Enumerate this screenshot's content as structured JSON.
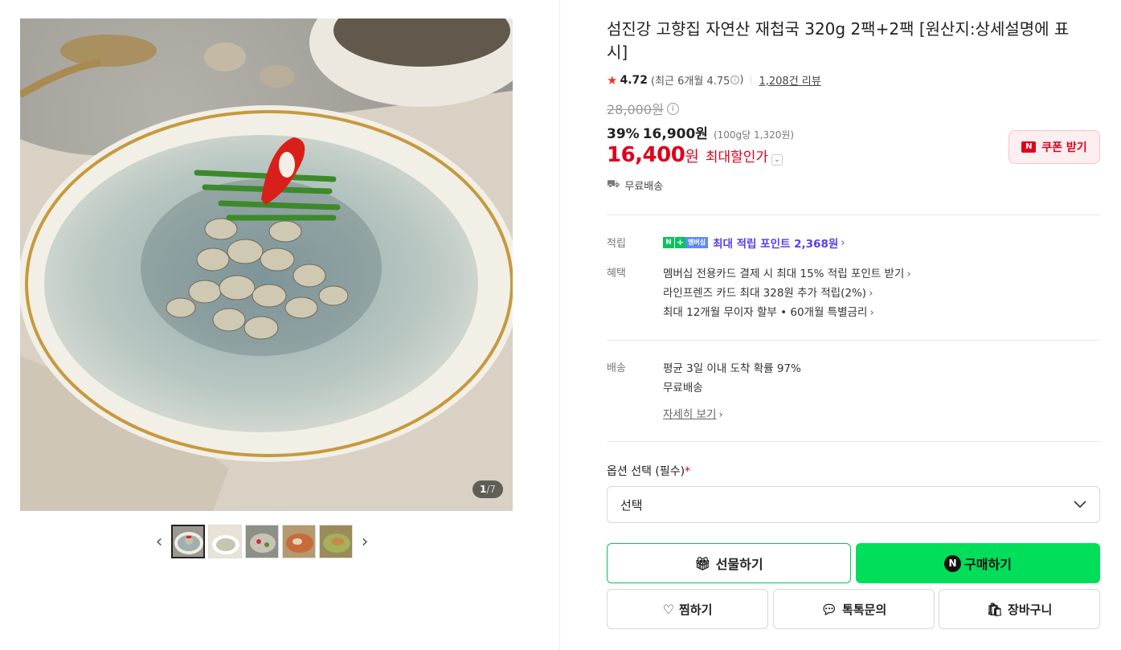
{
  "gallery": {
    "counter_current": "1",
    "counter_total": "/7",
    "prev_icon": "chevron-left-icon",
    "next_icon": "chevron-right-icon"
  },
  "product": {
    "title": "섬진강 고향집 자연산 재첩국 320g 2팩+2팩 [원산지:상세설명에 표시]",
    "rating_score": "4.72",
    "rating_recent": "(최근 6개월 4.75",
    "rating_recent_close": ")",
    "review_count": "1,208건 리뷰",
    "original_price": "28,000원",
    "discount_pct": "39%",
    "sale_price": "16,900원",
    "unit_price": "(100g당 1,320원)",
    "max_price_num": "16,400",
    "max_price_won": "원",
    "max_price_label": "최대할인가",
    "coupon_label": "쿠폰 받기",
    "coupon_logo": "N",
    "free_shipping": "무료배송"
  },
  "benefits": {
    "points_label": "적립",
    "points_n": "N",
    "points_plus": "+",
    "points_membership": "멤버십",
    "points_text": "최대 적립 포인트 2,368원",
    "benefit_label": "혜택",
    "benefit_items": [
      "멤버십 전용카드 결제 시 최대 15% 적립 포인트 받기",
      "라인프렌즈 카드 최대 328원 추가 적립(2%)",
      "최대 12개월 무이자 할부 • 60개월 특별금리"
    ]
  },
  "delivery": {
    "label": "배송",
    "line1": "평균 3일 이내 도착 확률 97%",
    "line2": "무료배송",
    "details_link": "자세히 보기"
  },
  "options": {
    "label": "옵션 선택 (필수)",
    "required_mark": "*",
    "select_value": "선택"
  },
  "actions": {
    "gift": "선물하기",
    "buy": "구매하기",
    "buy_badge": "N",
    "wish": "찜하기",
    "talk": "톡톡문의",
    "cart": "장바구니"
  },
  "colors": {
    "accent_green": "#00de5a",
    "price_red": "#e0001c",
    "point_purple": "#5b3cf0"
  }
}
